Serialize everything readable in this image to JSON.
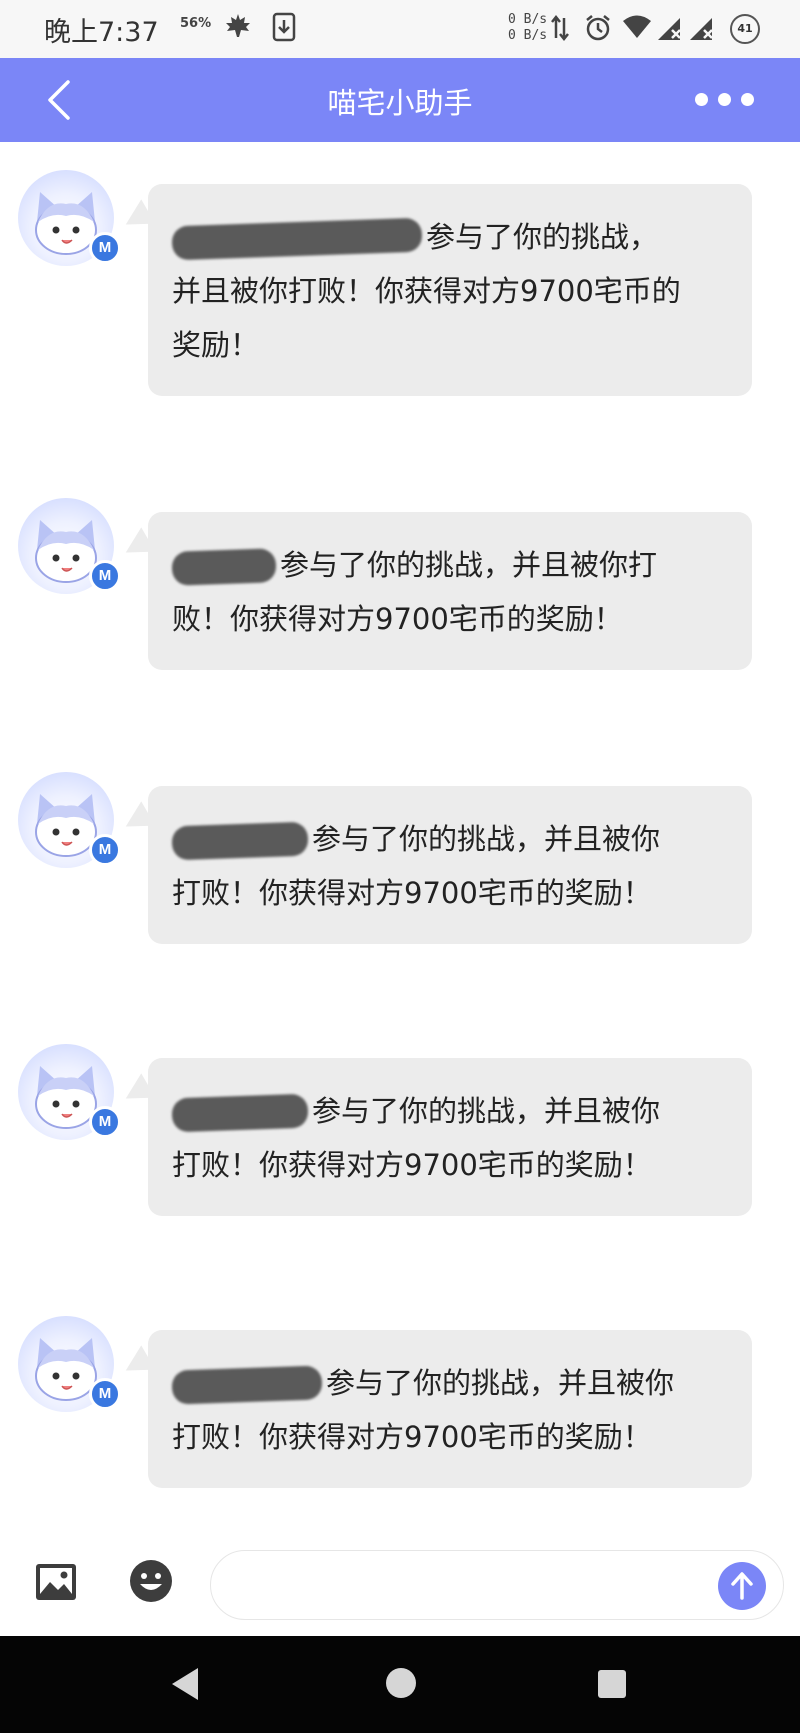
{
  "status_bar": {
    "time": "晚上7:37",
    "battery_percent_small": "56%",
    "net_up": "0 B/s",
    "net_down": "0 B/s",
    "battery_level": "41"
  },
  "header": {
    "title": "喵宅小助手",
    "back_icon": "chevron-left-icon",
    "more_icon": "more-horizontal-icon",
    "color": "#7b86f7"
  },
  "avatar_badge": "M",
  "messages": [
    {
      "line1": "参与了你的挑战，",
      "line2": "并且被你打败！你获得对方9700宅币的",
      "line3": "奖励！"
    },
    {
      "line1": "参与了你的挑战，并且被你打",
      "line2": "败！你获得对方9700宅币的奖励！"
    },
    {
      "line1": "参与了你的挑战，并且被你",
      "line2": "打败！你获得对方9700宅币的奖励！"
    },
    {
      "line1": "参与了你的挑战，并且被你",
      "line2": "打败！你获得对方9700宅币的奖励！"
    },
    {
      "line1": "参与了你的挑战，并且被你",
      "line2": "打败！你获得对方9700宅币的奖励！"
    }
  ],
  "input_bar": {
    "image_icon": "image-icon",
    "emoji_icon": "emoji-icon",
    "send_icon": "arrow-up-icon",
    "placeholder": ""
  },
  "nav_bar": {
    "back_icon": "triangle-back-icon",
    "home_icon": "circle-home-icon",
    "recent_icon": "square-recent-icon"
  }
}
